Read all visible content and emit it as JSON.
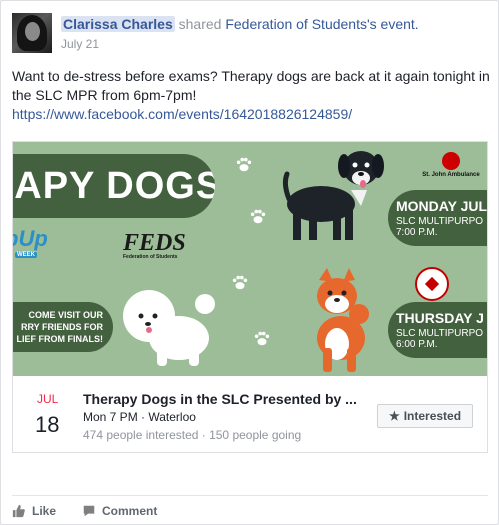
{
  "post": {
    "author_name": "Clarissa Charles",
    "shared_text": " shared ",
    "event_owner": "Federation of Students",
    "event_suffix": "'s event.",
    "date": "July 21",
    "body_text": "Want to de-stress before exams? Therapy dogs are back at it again tonight in the SLC MPR from 6pm-7pm!",
    "link": "https://www.facebook.com/events/1642018826124859/"
  },
  "banner": {
    "title": "RAPY DOGS",
    "day1": "MONDAY JUL",
    "loc1": "SLC MULTIPURPO",
    "time1": "7:00 P.M.",
    "day2": "THURSDAY J",
    "loc2": "SLC MULTIPURPO",
    "time2": "6:00 P.M.",
    "left_line1": "COME VISIT OUR",
    "left_line2": "RRY FRIENDS FOR",
    "left_line3": "LIEF FROM FINALS!",
    "popup": "pUp",
    "popup_week": "WEEK",
    "feds": "FEDS",
    "feds_sub": "Federation of Students",
    "ambulance": "St. John Ambulance",
    "bg_color": "#9dbd98",
    "pill_color": "#44613f"
  },
  "event": {
    "month": "JUL",
    "day": "18",
    "title": "Therapy Dogs in the SLC Presented by ...",
    "meta": "Mon 7 PM · Waterloo",
    "stats": "474 people interested · 150 people going",
    "interested_label": "Interested",
    "interested_icon": "star-icon"
  },
  "actions": {
    "like_label": "Like",
    "comment_label": "Comment",
    "like_icon": "thumbs-up-icon",
    "comment_icon": "speech-bubble-icon"
  }
}
